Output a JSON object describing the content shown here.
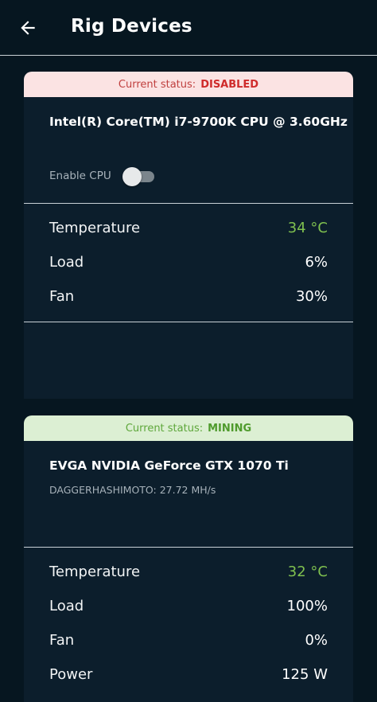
{
  "header": {
    "title": "Rig Devices"
  },
  "devices": [
    {
      "status_label": "Current status:",
      "status_value": "DISABLED",
      "name": "Intel(R) Core(TM) i7-9700K CPU @ 3.60GHz",
      "enable_label": "Enable CPU",
      "enabled": false,
      "stats": [
        {
          "label": "Temperature",
          "value": "34 °C"
        },
        {
          "label": "Load",
          "value": "6%"
        },
        {
          "label": "Fan",
          "value": "30%"
        }
      ]
    },
    {
      "status_label": "Current status:",
      "status_value": "MINING",
      "name": "EVGA NVIDIA GeForce GTX 1070 Ti",
      "algorithm": "DAGGERHASHIMOTO: 27.72 MH/s",
      "stats": [
        {
          "label": "Temperature",
          "value": "32 °C"
        },
        {
          "label": "Load",
          "value": "100%"
        },
        {
          "label": "Fan",
          "value": "0%"
        },
        {
          "label": "Power",
          "value": "125 W"
        }
      ]
    }
  ],
  "colors": {
    "background": "#061620",
    "card": "#0c1e2c",
    "disabled_status": "#cf2b2b",
    "mining_status": "#4f9b2d",
    "temperature": "#7fc04f"
  }
}
